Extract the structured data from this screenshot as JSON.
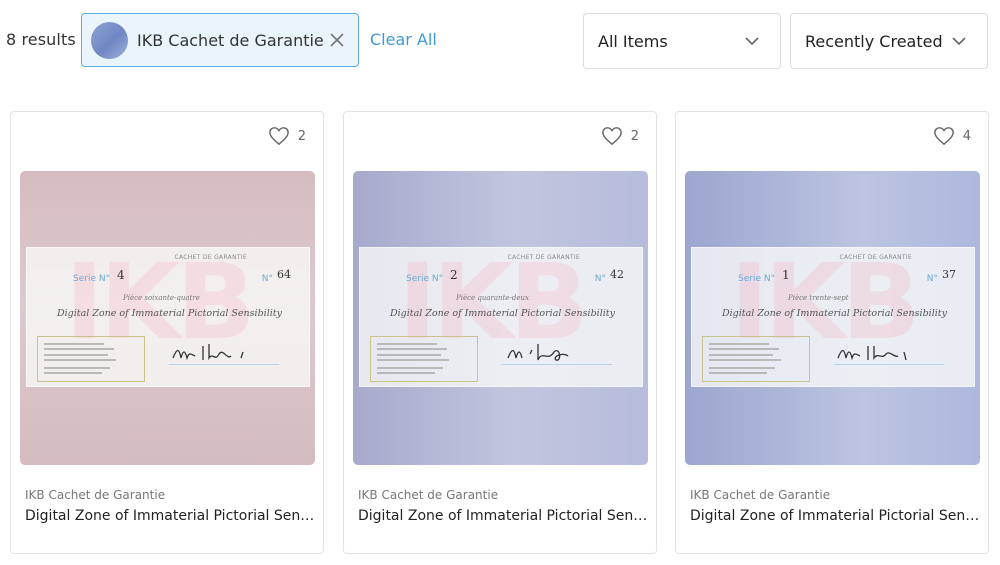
{
  "toolbar": {
    "results_count": "8 results",
    "filter_chip": {
      "label": "IKB Cachet de Garantie",
      "avatar": "gradient-avatar",
      "close_icon": "close-icon"
    },
    "clear_all_label": "Clear All",
    "items_select": {
      "selected": "All Items",
      "icon": "chevron-down-icon"
    },
    "sort_select": {
      "selected": "Recently Created",
      "icon": "chevron-down-icon"
    }
  },
  "cards": [
    {
      "likes": "2",
      "artist": "IKB Cachet de Garantie",
      "title": "Digital Zone of Immaterial Pictorial Sensibility",
      "certificate": {
        "header": "CACHET DE GARANTIE",
        "serie_label": "Serie N°",
        "serie_value": "4",
        "no_label": "N°",
        "no_value": "64",
        "line1": "Pièce soixante-quatre",
        "line2": "Digital Zone of Immaterial Pictorial Sensibility"
      }
    },
    {
      "likes": "2",
      "artist": "IKB Cachet de Garantie",
      "title": "Digital Zone of Immaterial Pictorial Sensibility",
      "certificate": {
        "header": "CACHET DE GARANTIE",
        "serie_label": "Serie N°",
        "serie_value": "2",
        "no_label": "N°",
        "no_value": "42",
        "line1": "Pièce quarante-deux",
        "line2": "Digital Zone of Immaterial Pictorial Sensibility"
      }
    },
    {
      "likes": "4",
      "artist": "IKB Cachet de Garantie",
      "title": "Digital Zone of Immaterial Pictorial Sensibility",
      "certificate": {
        "header": "CACHET DE GARANTIE",
        "serie_label": "Serie N°",
        "serie_value": "1",
        "no_label": "N°",
        "no_value": "37",
        "line1": "Pièce trente-sept",
        "line2": "Digital Zone of Immaterial Pictorial Sensibility"
      }
    }
  ],
  "icons": {
    "like": "heart-icon"
  },
  "colors": {
    "accent": "#3d9ad6",
    "chip_border": "#5fb0e0",
    "chip_bg": "#eaf5fb"
  }
}
